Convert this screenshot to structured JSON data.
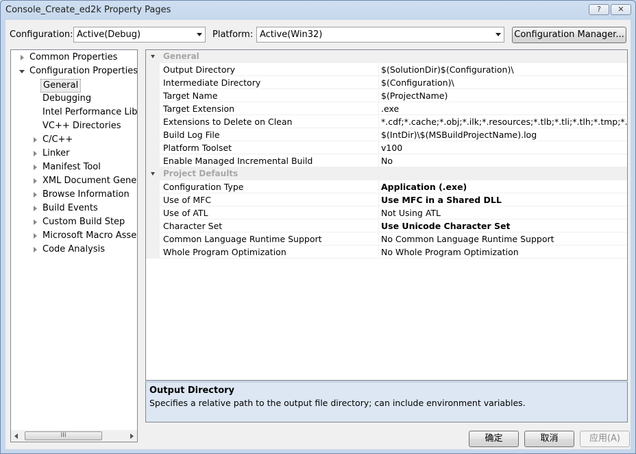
{
  "window": {
    "title": "Console_Create_ed2k Property Pages",
    "help_button": "?",
    "close_button": "✕"
  },
  "toolbar": {
    "configuration_label": "Configuration:",
    "configuration_value": "Active(Debug)",
    "platform_label": "Platform:",
    "platform_value": "Active(Win32)",
    "config_manager_label": "Configuration Manager..."
  },
  "tree": {
    "items": [
      {
        "label": "Common Properties",
        "level": 0,
        "state": "collapsed"
      },
      {
        "label": "Configuration Properties",
        "level": 0,
        "state": "expanded"
      },
      {
        "label": "General",
        "level": 1,
        "state": "leaf",
        "selected": true
      },
      {
        "label": "Debugging",
        "level": 1,
        "state": "leaf"
      },
      {
        "label": "Intel Performance Librar",
        "level": 1,
        "state": "leaf"
      },
      {
        "label": "VC++ Directories",
        "level": 1,
        "state": "leaf"
      },
      {
        "label": "C/C++",
        "level": 1,
        "state": "collapsed"
      },
      {
        "label": "Linker",
        "level": 1,
        "state": "collapsed"
      },
      {
        "label": "Manifest Tool",
        "level": 1,
        "state": "collapsed"
      },
      {
        "label": "XML Document Generat",
        "level": 1,
        "state": "collapsed"
      },
      {
        "label": "Browse Information",
        "level": 1,
        "state": "collapsed"
      },
      {
        "label": "Build Events",
        "level": 1,
        "state": "collapsed"
      },
      {
        "label": "Custom Build Step",
        "level": 1,
        "state": "collapsed"
      },
      {
        "label": "Microsoft Macro Assem",
        "level": 1,
        "state": "collapsed"
      },
      {
        "label": "Code Analysis",
        "level": 1,
        "state": "collapsed"
      }
    ],
    "scroll_thumb_glyph": "III"
  },
  "grid": {
    "sections": [
      {
        "title": "General",
        "rows": [
          {
            "name": "Output Directory",
            "value": "$(SolutionDir)$(Configuration)\\",
            "bold": false
          },
          {
            "name": "Intermediate Directory",
            "value": "$(Configuration)\\",
            "bold": false
          },
          {
            "name": "Target Name",
            "value": "$(ProjectName)",
            "bold": false
          },
          {
            "name": "Target Extension",
            "value": ".exe",
            "bold": false
          },
          {
            "name": "Extensions to Delete on Clean",
            "value": "*.cdf;*.cache;*.obj;*.ilk;*.resources;*.tlb;*.tli;*.tlh;*.tmp;*.rsp;*.pgc",
            "bold": false
          },
          {
            "name": "Build Log File",
            "value": "$(IntDir)\\$(MSBuildProjectName).log",
            "bold": false
          },
          {
            "name": "Platform Toolset",
            "value": "v100",
            "bold": false
          },
          {
            "name": "Enable Managed Incremental Build",
            "value": "No",
            "bold": false
          }
        ]
      },
      {
        "title": "Project Defaults",
        "rows": [
          {
            "name": "Configuration Type",
            "value": "Application (.exe)",
            "bold": true
          },
          {
            "name": "Use of MFC",
            "value": "Use MFC in a Shared DLL",
            "bold": true
          },
          {
            "name": "Use of ATL",
            "value": "Not Using ATL",
            "bold": false
          },
          {
            "name": "Character Set",
            "value": "Use Unicode Character Set",
            "bold": true
          },
          {
            "name": "Common Language Runtime Support",
            "value": "No Common Language Runtime Support",
            "bold": false
          },
          {
            "name": "Whole Program Optimization",
            "value": "No Whole Program Optimization",
            "bold": false
          }
        ]
      }
    ]
  },
  "description": {
    "title": "Output Directory",
    "text": "Specifies a relative path to the output file directory; can include environment variables."
  },
  "buttons": {
    "ok": "确定",
    "cancel": "取消",
    "apply": "应用(A)"
  }
}
